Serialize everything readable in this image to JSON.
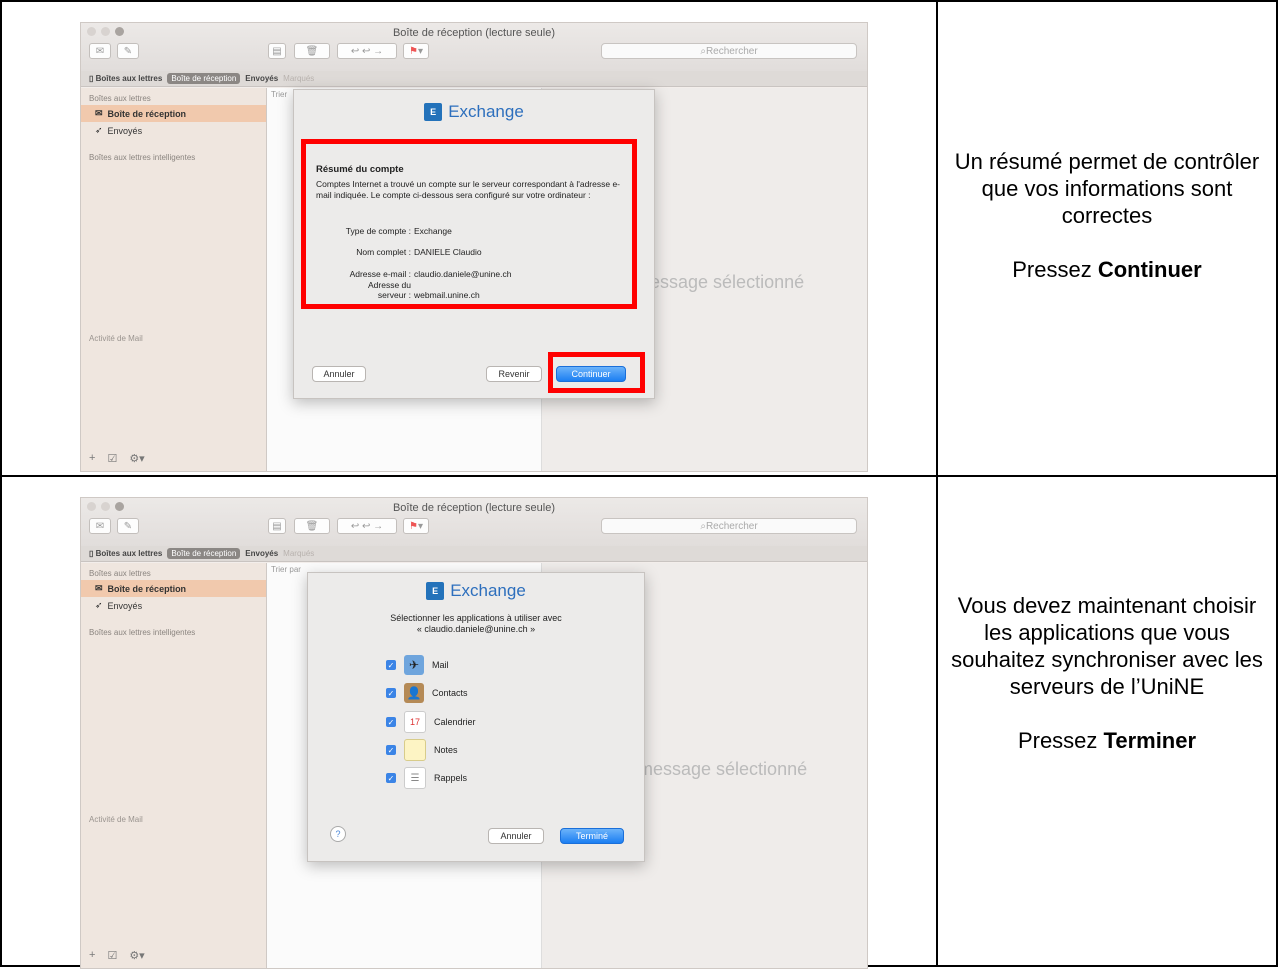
{
  "window": {
    "title": "Boîte de réception (lecture seule)",
    "search_placeholder": "Rechercher"
  },
  "favorites": {
    "mailboxes": "Boîtes aux lettres",
    "inbox": "Boîte de réception",
    "sent": "Envoyés",
    "flagged": "Marqués"
  },
  "sidebar": {
    "header": "Boîtes aux lettres",
    "inbox": "Boîte de réception",
    "sent": "Envoyés",
    "smart": "Boîtes aux lettres intelligentes",
    "activity": "Activité de Mail"
  },
  "list": {
    "sort_top": "Trier",
    "sort_bottom": "Trier par"
  },
  "viewer": {
    "no_message": "essage sélectionné",
    "no_message_bottom": "message sélectionné"
  },
  "dialog1": {
    "brand": "Exchange",
    "summary_title": "Résumé du compte",
    "summary_text": "Comptes Internet a trouvé un compte sur le serveur correspondant à l'adresse e-mail indiquée. Le compte ci-dessous sera configuré sur votre ordinateur :",
    "rows": [
      {
        "key": "Type de compte :",
        "value": "Exchange"
      },
      {
        "key": "Nom complet :",
        "value": "DANIELE Claudio"
      },
      {
        "key": "Adresse e-mail :",
        "value": "claudio.daniele@unine.ch"
      },
      {
        "key": "Adresse du serveur :",
        "value": "webmail.unine.ch"
      }
    ],
    "row4_key_line1": "Adresse du",
    "row4_key_line2": "serveur :",
    "cancel": "Annuler",
    "back": "Revenir",
    "continue": "Continuer"
  },
  "dialog2": {
    "brand": "Exchange",
    "prompt_line1": "Sélectionner les applications à utiliser avec",
    "prompt_line2": "« claudio.daniele@unine.ch »",
    "apps": [
      "Mail",
      "Contacts",
      "Calendrier",
      "Notes",
      "Rappels"
    ],
    "help": "?",
    "cancel": "Annuler",
    "done": "Terminé"
  },
  "instructions": {
    "top_text": "Un résumé permet de contrôler que vos informations sont correctes",
    "top_press": "Pressez ",
    "top_action": "Continuer",
    "bottom_text": "Vous devez maintenant choisir les applications que vous souhaitez synchroniser avec les serveurs de l’UniNE",
    "bottom_press": "Pressez ",
    "bottom_action": "Terminer"
  },
  "colors": {
    "highlight": "#ff0000",
    "accent": "#1b7ef2",
    "selection": "#f1c9ad"
  }
}
